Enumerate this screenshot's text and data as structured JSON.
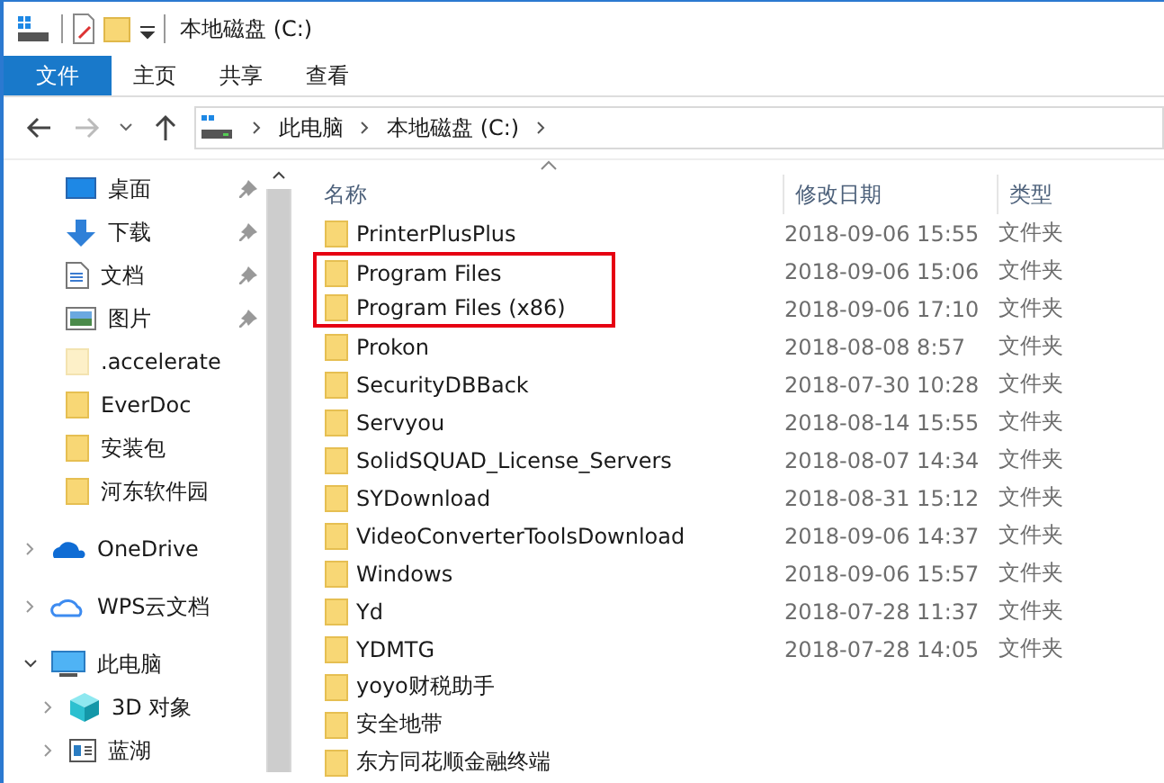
{
  "window": {
    "title": "本地磁盘 (C:)"
  },
  "ribbon_tabs": [
    {
      "label": "文件",
      "kind": "file",
      "selected": false
    },
    {
      "label": "主页",
      "kind": "tab",
      "selected": false
    },
    {
      "label": "共享",
      "kind": "tab",
      "selected": false
    },
    {
      "label": "查看",
      "kind": "tab",
      "selected": false
    }
  ],
  "address": {
    "segments": [
      "此电脑",
      "本地磁盘 (C:)"
    ]
  },
  "sidebar": {
    "items": [
      {
        "label": "桌面",
        "kind": "pinned"
      },
      {
        "label": "下载",
        "kind": "pinned"
      },
      {
        "label": "文档",
        "kind": "pinned"
      },
      {
        "label": "图片",
        "kind": "pinned"
      },
      {
        "label": ".accelerate",
        "kind": "folder",
        "faded": true
      },
      {
        "label": "EverDoc",
        "kind": "folder",
        "faded": false
      },
      {
        "label": "安装包",
        "kind": "folder",
        "faded": false
      },
      {
        "label": "河东软件园",
        "kind": "folder",
        "faded": false
      },
      {
        "label": "OneDrive",
        "kind": "root",
        "expanded": false
      },
      {
        "label": "WPS云文档",
        "kind": "root",
        "expanded": false
      },
      {
        "label": "此电脑",
        "kind": "root",
        "expanded": true
      },
      {
        "label": "3D 对象",
        "kind": "child",
        "expanded": false
      },
      {
        "label": "蓝湖",
        "kind": "child",
        "expanded": false
      }
    ]
  },
  "table": {
    "columns": [
      "名称",
      "修改日期",
      "类型"
    ],
    "rows": [
      {
        "name": "PrinterPlusPlus",
        "date": "2018-09-06 15:55",
        "type": "文件夹",
        "boxed": false
      },
      {
        "name": "Program Files",
        "date": "2018-09-06 15:06",
        "type": "文件夹",
        "boxed": true
      },
      {
        "name": "Program Files (x86)",
        "date": "2018-09-06 17:10",
        "type": "文件夹",
        "boxed": true
      },
      {
        "name": "Prokon",
        "date": "2018-08-08 8:57",
        "type": "文件夹",
        "boxed": false
      },
      {
        "name": "SecurityDBBack",
        "date": "2018-07-30 10:28",
        "type": "文件夹",
        "boxed": false
      },
      {
        "name": "Servyou",
        "date": "2018-08-14 15:55",
        "type": "文件夹",
        "boxed": false
      },
      {
        "name": "SolidSQUAD_License_Servers",
        "date": "2018-08-07 14:34",
        "type": "文件夹",
        "boxed": false
      },
      {
        "name": "SYDownload",
        "date": "2018-08-31 15:12",
        "type": "文件夹",
        "boxed": false
      },
      {
        "name": "VideoConverterToolsDownload",
        "date": "2018-09-06 14:37",
        "type": "文件夹",
        "boxed": false
      },
      {
        "name": "Windows",
        "date": "2018-09-06 15:57",
        "type": "文件夹",
        "boxed": false
      },
      {
        "name": "Yd",
        "date": "2018-07-28 11:37",
        "type": "文件夹",
        "boxed": false
      },
      {
        "name": "YDMTG",
        "date": "2018-07-28 14:05",
        "type": "文件夹",
        "boxed": false
      },
      {
        "name": "yoyo财税助手",
        "boxed": false
      },
      {
        "name": "安全地带",
        "boxed": false
      },
      {
        "name": "东方同花顺金融终端",
        "boxed": false
      }
    ]
  }
}
